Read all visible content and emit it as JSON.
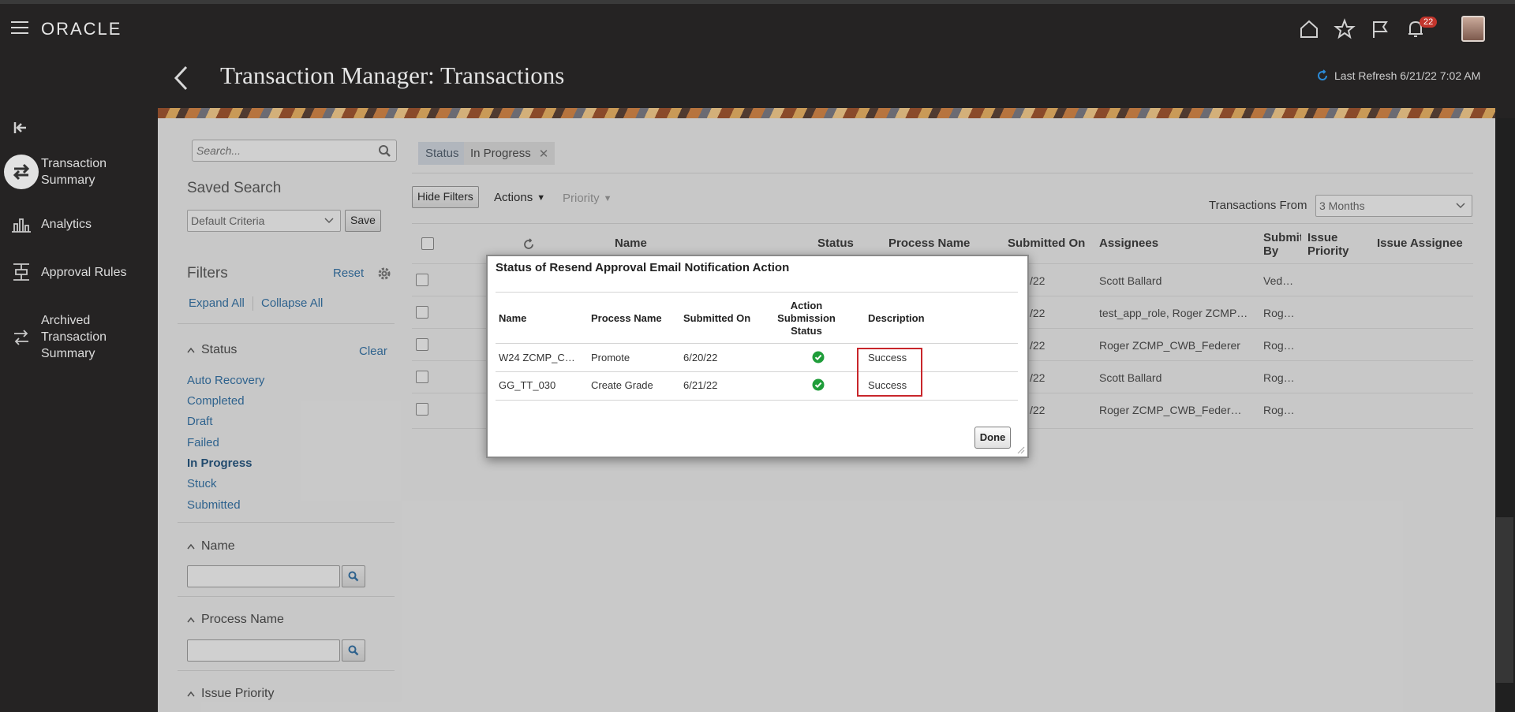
{
  "app": {
    "logo": "ORACLE",
    "notification_count": "22"
  },
  "page": {
    "title": "Transaction Manager: Transactions",
    "last_refresh": "Last Refresh 6/21/22 7:02 AM"
  },
  "nav": {
    "items": [
      {
        "label": "Transaction Summary",
        "icon": "swap-arrows-icon"
      },
      {
        "label": "Analytics",
        "icon": "analytics-icon"
      },
      {
        "label": "Approval Rules",
        "icon": "approval-rules-icon"
      },
      {
        "label": "Archived Transaction Summary",
        "icon": "archive-icon"
      }
    ]
  },
  "filters_panel": {
    "search_placeholder": "Search...",
    "saved_search_title": "Saved Search",
    "saved_search_value": "Default Criteria",
    "save_label": "Save",
    "filters_title": "Filters",
    "reset_label": "Reset",
    "expand_all": "Expand All",
    "collapse_all": "Collapse All",
    "status_title": "Status",
    "clear_label": "Clear",
    "status_options": [
      "Auto Recovery",
      "Completed",
      "Draft",
      "Failed",
      "In Progress",
      "Stuck",
      "Submitted"
    ],
    "status_selected": "In Progress",
    "name_title": "Name",
    "process_name_title": "Process Name",
    "issue_priority_title": "Issue Priority"
  },
  "applied_filter": {
    "label": "Status",
    "value": "In Progress"
  },
  "toolbar": {
    "hide_filters": "Hide Filters",
    "actions": "Actions",
    "priority": "Priority",
    "transactions_from_label": "Transactions From",
    "transactions_from_value": "3 Months"
  },
  "table": {
    "headers": {
      "name": "Name",
      "status": "Status",
      "process_name": "Process Name",
      "submitted_on": "Submitted On",
      "assignees": "Assignees",
      "submitted_by": "Submitted By",
      "issue_priority": "Issue Priority",
      "issue_assignee": "Issue Assignee"
    },
    "rows": [
      {
        "submitted_on": "/22",
        "assignees": "Scott Ballard",
        "submitted_by": "Ved…"
      },
      {
        "submitted_on": "/22",
        "assignees": "test_app_role, Roger ZCMP…",
        "submitted_by": "Rog…"
      },
      {
        "submitted_on": "/22",
        "assignees": "Roger ZCMP_CWB_Federer",
        "submitted_by": "Rog…"
      },
      {
        "submitted_on": "/22",
        "assignees": "Scott Ballard",
        "submitted_by": "Rog…"
      },
      {
        "submitted_on": "/22",
        "assignees": "Roger ZCMP_CWB_Feder…",
        "submitted_by": "Rog…"
      }
    ]
  },
  "dialog": {
    "title": "Status of Resend Approval Email Notification Action",
    "headers": {
      "name": "Name",
      "process_name": "Process Name",
      "submitted_on": "Submitted On",
      "action_status_1": "Action",
      "action_status_2": "Submission",
      "action_status_3": "Status",
      "description": "Description"
    },
    "rows": [
      {
        "name": "W24 ZCMP_C…",
        "process_name": "Promote",
        "submitted_on": "6/20/22",
        "status_icon": "success-check-icon",
        "description": "Success"
      },
      {
        "name": "GG_TT_030",
        "process_name": "Create Grade",
        "submitted_on": "6/21/22",
        "status_icon": "success-check-icon",
        "description": "Success"
      }
    ],
    "done_label": "Done"
  },
  "colors": {
    "accent": "#2b6fa8",
    "success": "#1f9d3a",
    "highlight": "#c8262b",
    "badge": "#c2352c"
  }
}
